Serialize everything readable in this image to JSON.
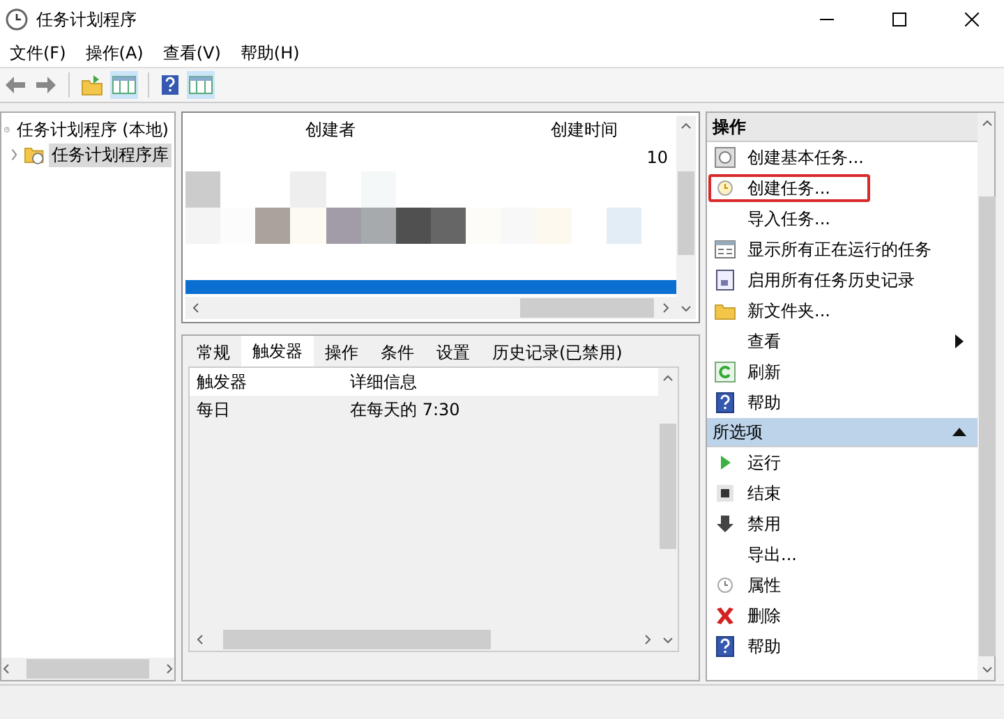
{
  "window": {
    "title": "任务计划程序"
  },
  "menu": [
    "文件(F)",
    "操作(A)",
    "查看(V)",
    "帮助(H)"
  ],
  "tree": [
    {
      "label": "任务计划程序 (本地)",
      "selected": false,
      "children": [
        {
          "label": "任务计划程序库",
          "selected": true,
          "expanded": false
        }
      ]
    }
  ],
  "task_list": {
    "columns": [
      "创建者",
      "创建时间"
    ],
    "visible_cell": "10"
  },
  "detail": {
    "tabs": [
      {
        "label": "常规",
        "selected": false
      },
      {
        "label": "触发器",
        "selected": true
      },
      {
        "label": "操作",
        "selected": false
      },
      {
        "label": "条件",
        "selected": false
      },
      {
        "label": "设置",
        "selected": false
      },
      {
        "label": "历史记录(已禁用)",
        "selected": false
      }
    ],
    "columns": [
      "触发器",
      "详细信息"
    ],
    "rows": [
      [
        "每日",
        "在每天的 7:30"
      ]
    ]
  },
  "actions": [
    {
      "title": "操作",
      "active": false,
      "items": [
        {
          "label": "创建基本任务...",
          "kind": "wizard",
          "highlighted": false
        },
        {
          "label": "创建任务...",
          "kind": "task",
          "highlighted": true
        },
        {
          "label": "导入任务...",
          "kind": "plain",
          "highlighted": false
        },
        {
          "label": "显示所有正在运行的任务",
          "kind": "list",
          "highlighted": false
        },
        {
          "label": "启用所有任务历史记录",
          "kind": "history",
          "highlighted": false
        },
        {
          "label": "新文件夹...",
          "kind": "folder",
          "highlighted": false
        },
        {
          "label": "查看",
          "kind": "submenu",
          "highlighted": false
        },
        {
          "label": "刷新",
          "kind": "refresh",
          "highlighted": false
        },
        {
          "label": "帮助",
          "kind": "help",
          "highlighted": false
        }
      ]
    },
    {
      "title": "所选项",
      "active": true,
      "expanded": true,
      "items": [
        {
          "label": "运行",
          "kind": "run",
          "highlighted": false
        },
        {
          "label": "结束",
          "kind": "stop",
          "highlighted": false
        },
        {
          "label": "禁用",
          "kind": "disable",
          "highlighted": false
        },
        {
          "label": "导出...",
          "kind": "plain",
          "highlighted": false
        },
        {
          "label": "属性",
          "kind": "properties",
          "highlighted": false
        },
        {
          "label": "删除",
          "kind": "delete",
          "highlighted": false
        },
        {
          "label": "帮助",
          "kind": "help",
          "highlighted": false
        }
      ]
    }
  ]
}
